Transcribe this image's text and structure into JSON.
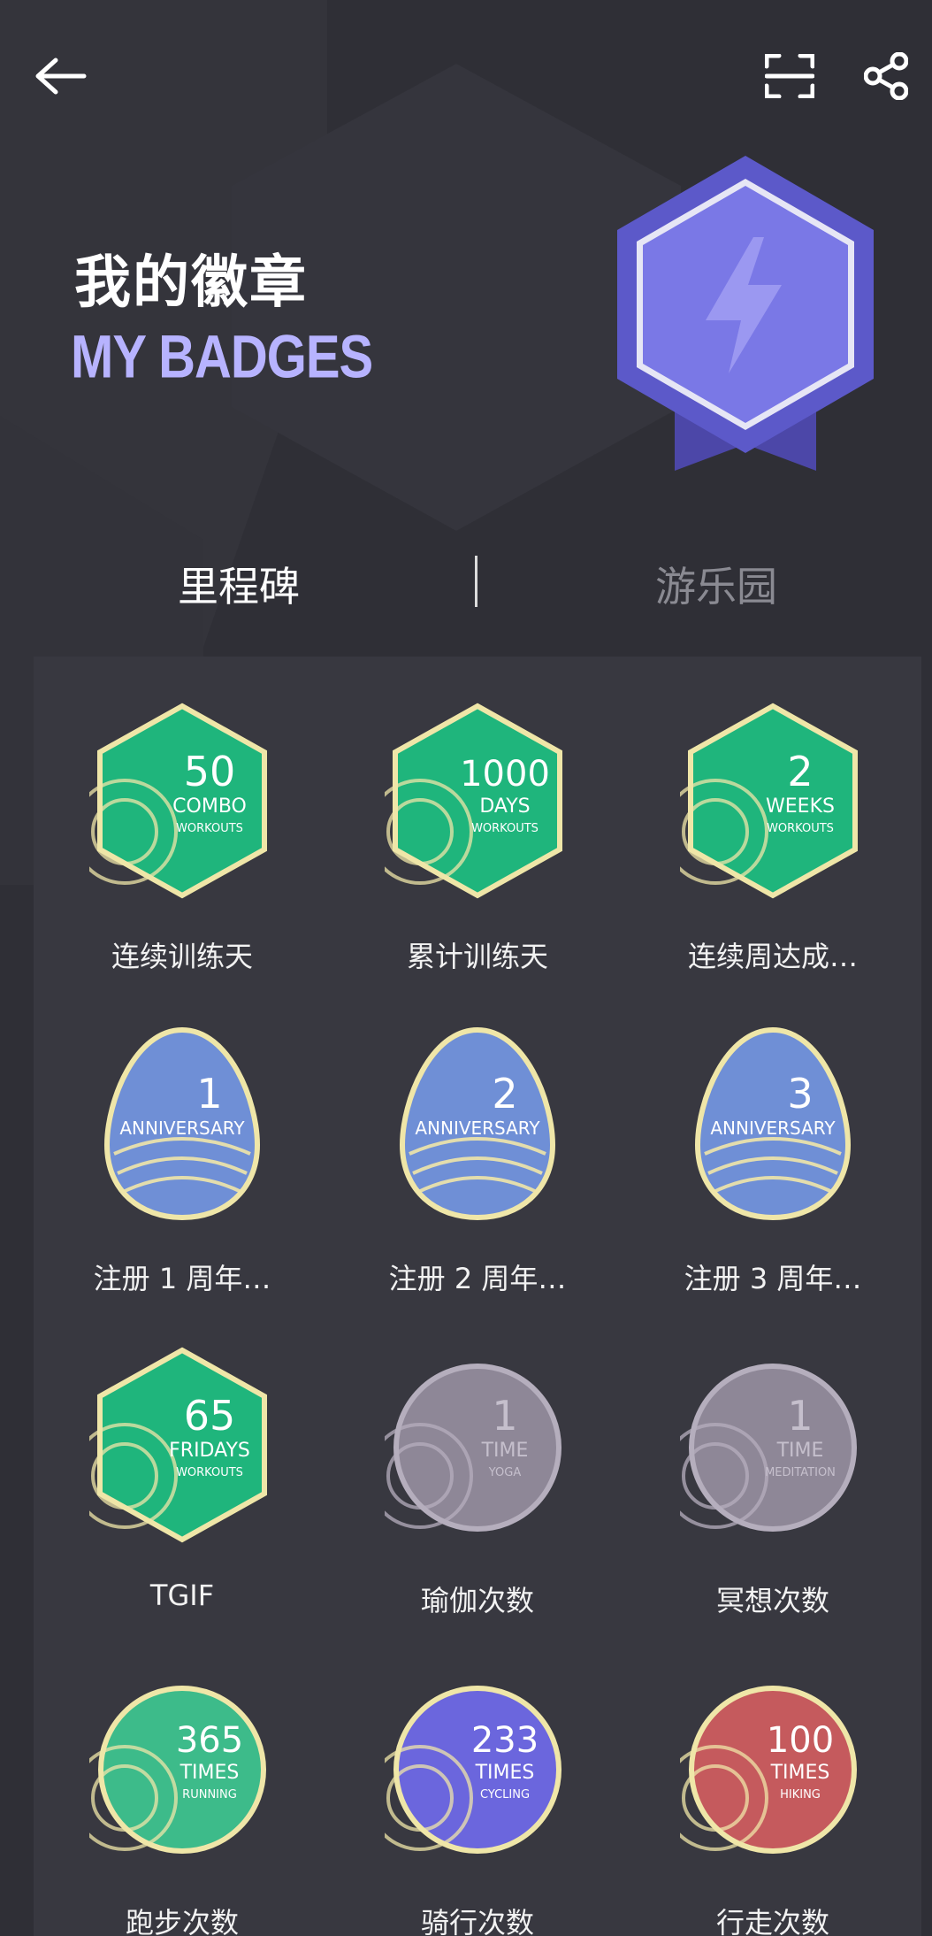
{
  "header": {
    "title_cn": "我的徽章",
    "title_en": "MY BADGES",
    "back_icon": "arrow-left-icon",
    "scan_icon": "scan-icon",
    "share_icon": "share-icon"
  },
  "tabs": [
    {
      "label": "里程碑",
      "active": true
    },
    {
      "label": "游乐园",
      "active": false
    }
  ],
  "colors": {
    "background": "#2f2f36",
    "panel": "#383840",
    "accent_purple": "#7a78e6",
    "badge_green": "#1fb57c",
    "badge_blue": "#6f8fd6",
    "badge_locked": "#8e8797",
    "badge_red": "#c55a5d",
    "badge_gold_rim": "#efe6a8"
  },
  "badges": [
    {
      "label": "连续训练天",
      "big": "50",
      "line1": "COMBO",
      "line2": "WORKOUTS",
      "shape": "hexagon",
      "color": "#1fb57c",
      "earned": true
    },
    {
      "label": "累计训练天",
      "big": "1000",
      "line1": "DAYS",
      "line2": "WORKOUTS",
      "shape": "hexagon",
      "color": "#1fb57c",
      "earned": true
    },
    {
      "label": "连续周达成…",
      "big": "2",
      "line1": "WEEKS",
      "line2": "WORKOUTS",
      "shape": "hexagon",
      "color": "#1fb57c",
      "earned": true
    },
    {
      "label": "注册 1 周年…",
      "big": "1",
      "line1": "ANNIVERSARY",
      "line2": "",
      "shape": "egg",
      "color": "#6f8fd6",
      "earned": true
    },
    {
      "label": "注册 2 周年…",
      "big": "2",
      "line1": "ANNIVERSARY",
      "line2": "",
      "shape": "egg",
      "color": "#6f8fd6",
      "earned": true
    },
    {
      "label": "注册 3 周年…",
      "big": "3",
      "line1": "ANNIVERSARY",
      "line2": "",
      "shape": "egg",
      "color": "#6f8fd6",
      "earned": true
    },
    {
      "label": "TGIF",
      "big": "65",
      "line1": "FRIDAYS",
      "line2": "WORKOUTS",
      "shape": "hexagon",
      "color": "#1fb57c",
      "earned": true
    },
    {
      "label": "瑜伽次数",
      "big": "1",
      "line1": "TIME",
      "line2": "YOGA",
      "shape": "circle",
      "color": "#8e8797",
      "earned": false
    },
    {
      "label": "冥想次数",
      "big": "1",
      "line1": "TIME",
      "line2": "MEDITATION",
      "shape": "circle",
      "color": "#8e8797",
      "earned": false
    },
    {
      "label": "跑步次数",
      "big": "365",
      "line1": "TIMES",
      "line2": "RUNNING",
      "shape": "circle",
      "color": "#3dbb8a",
      "earned": true
    },
    {
      "label": "骑行次数",
      "big": "233",
      "line1": "TIMES",
      "line2": "CYCLING",
      "shape": "circle",
      "color": "#6b66dd",
      "earned": true
    },
    {
      "label": "行走次数",
      "big": "100",
      "line1": "TIMES",
      "line2": "HIKING",
      "shape": "circle",
      "color": "#c55a5d",
      "earned": true
    }
  ]
}
